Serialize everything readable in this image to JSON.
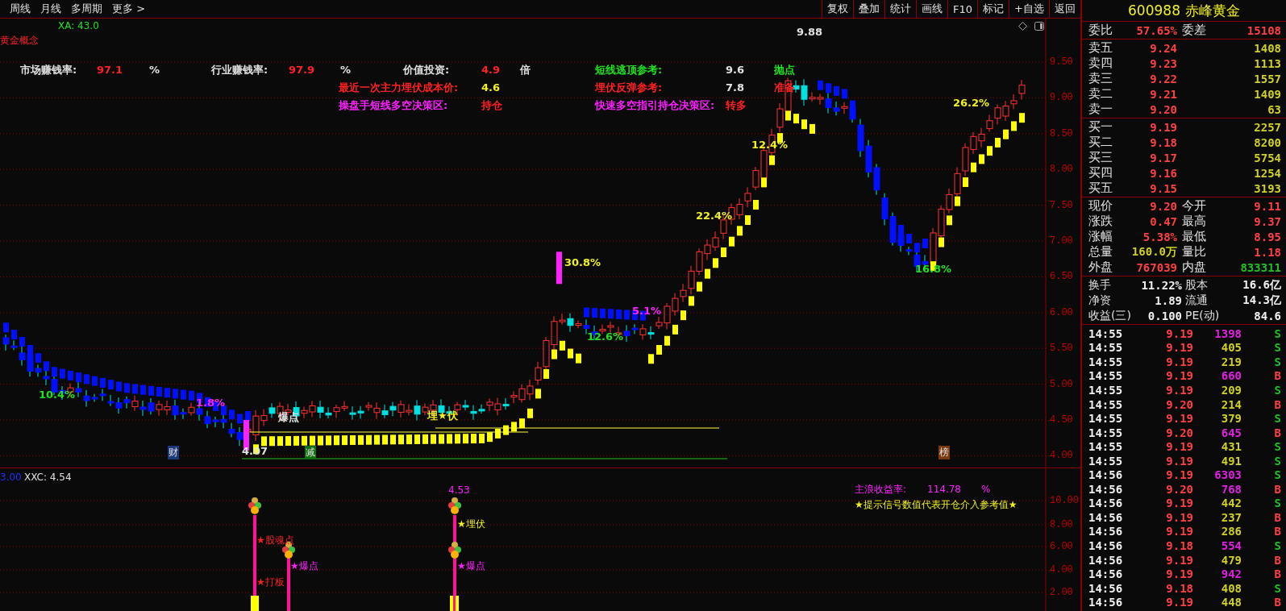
{
  "toolbar": {
    "left": [
      "周线",
      "月线",
      "多周期",
      "更多 >"
    ],
    "right": [
      "复权",
      "叠加",
      "统计",
      "画线",
      "F10",
      "标记",
      "+自选",
      "返回"
    ]
  },
  "chart": {
    "xa": "XA: 43.0",
    "concept": "黄金概念",
    "y_ticks": [
      "9.50",
      "9.00",
      "8.50",
      "8.00",
      "7.50",
      "7.00",
      "6.50",
      "6.00",
      "5.50",
      "5.00",
      "4.50",
      "4.00"
    ],
    "info": [
      {
        "text": "市场赚钱率:",
        "color": "#e0e0e0"
      },
      {
        "text": "97.1",
        "color": "#ff2020"
      },
      {
        "text": "%",
        "color": "#e0e0e0"
      },
      {
        "text": "行业赚钱率:",
        "color": "#e0e0e0"
      },
      {
        "text": "97.9",
        "color": "#ff2020"
      },
      {
        "text": "%",
        "color": "#e0e0e0"
      },
      {
        "text": "价值投资:",
        "color": "#e0e0e0"
      },
      {
        "text": "4.9",
        "color": "#ff2020"
      },
      {
        "text": "倍",
        "color": "#e0e0e0"
      },
      {
        "text": "短线逃顶参考:",
        "color": "#20e020"
      },
      {
        "text": "9.6",
        "color": "#e0e0e0"
      },
      {
        "text": "抛点",
        "color": "#20e020"
      },
      {
        "text": "最近一次主力埋伏成本价:",
        "color": "#ff2020"
      },
      {
        "text": "4.6",
        "color": "#f0f020"
      },
      {
        "text": "埋伏反弹参考:",
        "color": "#ff2020"
      },
      {
        "text": "7.8",
        "color": "#e0e0e0"
      },
      {
        "text": "准备",
        "color": "#ff2020"
      },
      {
        "text": "操盘手短线多空决策区:",
        "color": "#ff20ff"
      },
      {
        "text": "持仓",
        "color": "#ff2020"
      },
      {
        "text": "快速多空指引持仓决策区:",
        "color": "#ff20ff"
      },
      {
        "text": "转多",
        "color": "#ff2020"
      }
    ],
    "annotations": [
      {
        "text": "9.88",
        "color": "#e0e0e0"
      },
      {
        "text": "30.8%",
        "color": "#f0f020"
      },
      {
        "text": "22.4%",
        "color": "#f0f020"
      },
      {
        "text": "12.4%",
        "color": "#f0f020"
      },
      {
        "text": "26.2%",
        "color": "#f0f020"
      },
      {
        "text": "16.8%",
        "color": "#20e020"
      },
      {
        "text": "5.1%",
        "color": "#ff20ff"
      },
      {
        "text": "12.6%",
        "color": "#20e020"
      },
      {
        "text": "10.4%",
        "color": "#20e020"
      },
      {
        "text": "1.8%",
        "color": "#ff20ff"
      },
      {
        "text": "4.07",
        "color": "#e0e0e0"
      },
      {
        "text": "爆点",
        "color": "#e0e0e0"
      },
      {
        "text": "埋★伏",
        "color": "#f0f020"
      }
    ],
    "markers": [
      {
        "text": "财",
        "color": "#1a3a7a"
      },
      {
        "text": "减",
        "color": "#107010"
      },
      {
        "text": "榜",
        "color": "#7a3a10"
      }
    ]
  },
  "indicator": {
    "base": "3.00",
    "name": "XXC: 4.54",
    "peak": "4.53",
    "y_ticks": [
      "10.00",
      "8.00",
      "6.00",
      "4.00",
      "2.00"
    ],
    "signals": [
      {
        "text": "★股魂点",
        "color": "#ff2020"
      },
      {
        "text": "★打板",
        "color": "#ff2020"
      },
      {
        "text": "★爆点",
        "color": "#ff20ff"
      },
      {
        "text": "★埋伏",
        "color": "#f0f020"
      },
      {
        "text": "★爆点",
        "color": "#ff20ff"
      }
    ],
    "yield_label": "主浪收益率:",
    "yield_value": "114.78",
    "yield_unit": "%",
    "hint": "★提示信号数值代表开仓介入参考值★"
  },
  "quote": {
    "code": "600988",
    "name": "赤峰黄金",
    "ratio": {
      "label": "委比",
      "value": "57.65%",
      "label2": "委差",
      "value2": "15108"
    },
    "asks": [
      {
        "label": "卖五",
        "price": "9.24",
        "volume": "1408"
      },
      {
        "label": "卖四",
        "price": "9.23",
        "volume": "1113"
      },
      {
        "label": "卖三",
        "price": "9.22",
        "volume": "1557"
      },
      {
        "label": "卖二",
        "price": "9.21",
        "volume": "1409"
      },
      {
        "label": "卖一",
        "price": "9.20",
        "volume": "63"
      }
    ],
    "bids": [
      {
        "label": "买一",
        "price": "9.19",
        "volume": "2257"
      },
      {
        "label": "买二",
        "price": "9.18",
        "volume": "8200"
      },
      {
        "label": "买三",
        "price": "9.17",
        "volume": "5754"
      },
      {
        "label": "买四",
        "price": "9.16",
        "volume": "1254"
      },
      {
        "label": "买五",
        "price": "9.15",
        "volume": "3193"
      }
    ],
    "stats": [
      {
        "cells": [
          {
            "label": "现价",
            "value": "9.20",
            "color": "#ff4040"
          },
          {
            "label": "今开",
            "value": "9.11",
            "color": "#ff4040"
          }
        ]
      },
      {
        "cells": [
          {
            "label": "涨跌",
            "value": "0.47",
            "color": "#ff4040"
          },
          {
            "label": "最高",
            "value": "9.37",
            "color": "#ff4040"
          }
        ]
      },
      {
        "cells": [
          {
            "label": "涨幅",
            "value": "5.38%",
            "color": "#ff4040"
          },
          {
            "label": "最低",
            "value": "8.95",
            "color": "#ff4040"
          }
        ]
      },
      {
        "cells": [
          {
            "label": "总量",
            "value": "160.0万",
            "color": "#d0d020"
          },
          {
            "label": "量比",
            "value": "1.18",
            "color": "#ff4040"
          }
        ]
      },
      {
        "cells": [
          {
            "label": "外盘",
            "value": "767039",
            "color": "#ff4040"
          },
          {
            "label": "内盘",
            "value": "833311",
            "color": "#20c020"
          }
        ]
      }
    ],
    "fundamentals": [
      {
        "label": "换手",
        "value": "11.22%",
        "label2": "股本",
        "value2": "16.6亿"
      },
      {
        "label": "净资",
        "value": "1.89",
        "label2": "流通",
        "value2": "14.3亿"
      },
      {
        "label": "收益(三)",
        "value": "0.100",
        "label2": "PE(动)",
        "value2": "84.6"
      }
    ],
    "ticks": [
      {
        "time": "14:55",
        "price": "9.19",
        "volume": "1398",
        "large": true,
        "side": "S",
        "kind": "sell"
      },
      {
        "time": "14:55",
        "price": "9.19",
        "volume": "405",
        "large": false,
        "side": "S",
        "kind": "sell"
      },
      {
        "time": "14:55",
        "price": "9.19",
        "volume": "219",
        "large": false,
        "side": "S",
        "kind": "sell"
      },
      {
        "time": "14:55",
        "price": "9.19",
        "volume": "660",
        "large": true,
        "side": "B",
        "kind": "buy"
      },
      {
        "time": "14:55",
        "price": "9.19",
        "volume": "209",
        "large": false,
        "side": "S",
        "kind": "sell"
      },
      {
        "time": "14:55",
        "price": "9.20",
        "volume": "214",
        "large": false,
        "side": "B",
        "kind": "buy"
      },
      {
        "time": "14:55",
        "price": "9.19",
        "volume": "379",
        "large": false,
        "side": "S",
        "kind": "sell"
      },
      {
        "time": "14:55",
        "price": "9.20",
        "volume": "645",
        "large": true,
        "side": "B",
        "kind": "buy"
      },
      {
        "time": "14:55",
        "price": "9.19",
        "volume": "431",
        "large": false,
        "side": "S",
        "kind": "sell"
      },
      {
        "time": "14:55",
        "price": "9.19",
        "volume": "491",
        "large": false,
        "side": "S",
        "kind": "sell"
      },
      {
        "time": "14:56",
        "price": "9.19",
        "volume": "6303",
        "large": true,
        "side": "S",
        "kind": "sell"
      },
      {
        "time": "14:56",
        "price": "9.20",
        "volume": "768",
        "large": true,
        "side": "B",
        "kind": "buy"
      },
      {
        "time": "14:56",
        "price": "9.19",
        "volume": "442",
        "large": false,
        "side": "S",
        "kind": "sell"
      },
      {
        "time": "14:56",
        "price": "9.19",
        "volume": "237",
        "large": false,
        "side": "B",
        "kind": "buy"
      },
      {
        "time": "14:56",
        "price": "9.19",
        "volume": "286",
        "large": false,
        "side": "B",
        "kind": "buy"
      },
      {
        "time": "14:56",
        "price": "9.18",
        "volume": "554",
        "large": true,
        "side": "S",
        "kind": "sell"
      },
      {
        "time": "14:56",
        "price": "9.19",
        "volume": "479",
        "large": false,
        "side": "B",
        "kind": "buy"
      },
      {
        "time": "14:56",
        "price": "9.19",
        "volume": "942",
        "large": true,
        "side": "B",
        "kind": "buy"
      },
      {
        "time": "14:56",
        "price": "9.18",
        "volume": "408",
        "large": false,
        "side": "S",
        "kind": "sell"
      },
      {
        "time": "14:56",
        "price": "9.19",
        "volume": "448",
        "large": false,
        "side": "B",
        "kind": "buy"
      }
    ]
  }
}
